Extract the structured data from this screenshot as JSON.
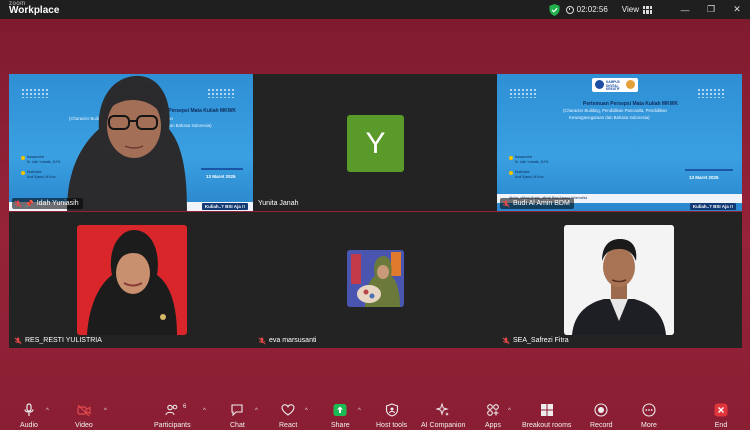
{
  "app": {
    "brand_small": "zoom",
    "brand_big": "Workplace"
  },
  "titlebar": {
    "timer": "02:02:56",
    "view_label": "View"
  },
  "slide": {
    "title": "Pertemuan Persepsi Mata Kuliah MKWK",
    "subtitle_line1": "(Character Building, Pendidikan Pancasila, Pendidikan",
    "subtitle_line2": "Kewarganegaraan dan Bahasa Indonesia)",
    "narasumber_label": "Narasumber",
    "narasumber_name": "Dr. Idah Yuniasih, M.Pd",
    "moderator_label": "Moderator",
    "moderator_name": "Asril Syarwi, M.Kom",
    "date": "13 Maret 2025",
    "footer_social": "@ubsi_official   @ubsi_official   Bina Sarana Informatika",
    "footer_tagline": "Kuliah..? BSI Aja !!",
    "logo_text": "KAMPUS DIGITAL KREATIF"
  },
  "participants": [
    {
      "name": "Idah Yuniasih",
      "pinned": true,
      "muted": true,
      "active": true
    },
    {
      "name": "Yunita Janah",
      "initial": "Y",
      "muted": false
    },
    {
      "name": "Budi Al Amin BDM",
      "muted": true
    },
    {
      "name": "RES_RESTI YULISTRIA",
      "muted": true
    },
    {
      "name": "eva marsusanti",
      "muted": true
    },
    {
      "name": "SEA_Safrezi Fitra",
      "muted": true
    }
  ],
  "toolbar": {
    "audio": "Audio",
    "video": "Video",
    "participants": "Participants",
    "participants_count": "6",
    "chat": "Chat",
    "react": "React",
    "share": "Share",
    "host_tools": "Host tools",
    "ai_companion": "AI Companion",
    "apps": "Apps",
    "breakout_rooms": "Breakout rooms",
    "record": "Record",
    "more": "More",
    "end": "End"
  },
  "colors": {
    "background": "#8c1f33",
    "active_speaker": "#2fbf5a",
    "share_green": "#1db954",
    "end_red": "#e0353b",
    "avatar_green": "#5a9a2a"
  }
}
